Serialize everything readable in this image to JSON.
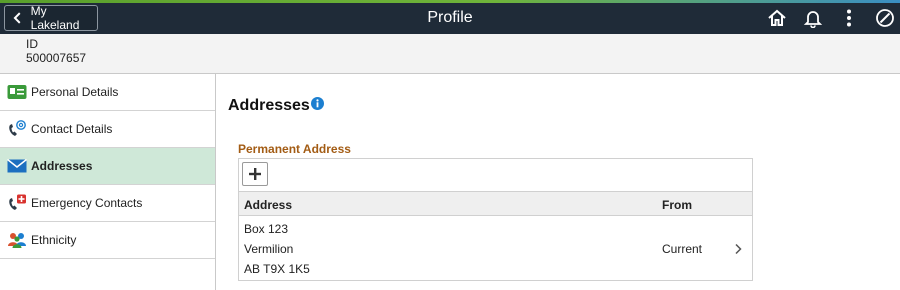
{
  "header": {
    "back_label": "My Lakeland",
    "title": "Profile",
    "icons": [
      "home-icon",
      "bell-icon",
      "more-vertical-icon",
      "compass-icon"
    ]
  },
  "id_bar": {
    "label": "ID",
    "value": "500007657"
  },
  "sidebar": {
    "items": [
      {
        "label": "Personal Details",
        "icon": "id-card-icon"
      },
      {
        "label": "Contact Details",
        "icon": "phone-email-icon"
      },
      {
        "label": "Addresses",
        "icon": "envelope-icon",
        "active": true
      },
      {
        "label": "Emergency Contacts",
        "icon": "emergency-phone-icon"
      },
      {
        "label": "Ethnicity",
        "icon": "people-icon"
      }
    ]
  },
  "main": {
    "title": "Addresses",
    "section": {
      "title": "Permanent Address",
      "columns": [
        "Address",
        "From"
      ],
      "rows": [
        {
          "address": [
            "Box 123",
            "Vermilion",
            "AB T9X 1K5"
          ],
          "from": "Current"
        }
      ]
    }
  },
  "colors": {
    "topbar": "#1f2b38",
    "active_nav": "#cfe8d8",
    "section_heading": "#a35c14",
    "info": "#1c7fd0"
  }
}
